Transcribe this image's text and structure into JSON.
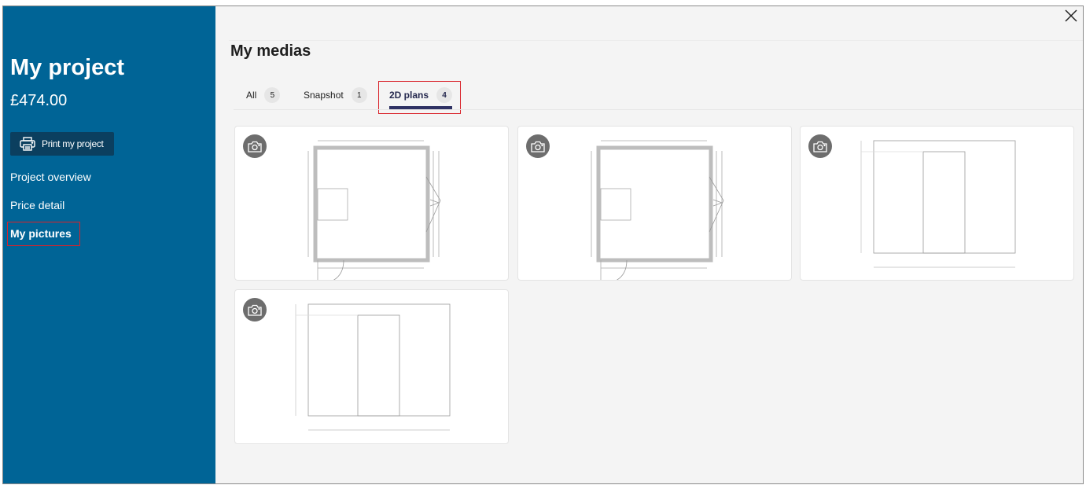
{
  "sidebar": {
    "title": "My project",
    "price": "£474.00",
    "print_label": "Print my project",
    "nav": [
      {
        "label": "Project overview",
        "active": false
      },
      {
        "label": "Price detail",
        "active": false
      },
      {
        "label": "My pictures",
        "active": true
      }
    ]
  },
  "main": {
    "title": "My medias",
    "tabs": [
      {
        "label": "All",
        "count": "5",
        "active": false
      },
      {
        "label": "Snapshot",
        "count": "1",
        "active": false
      },
      {
        "label": "2D plans",
        "count": "4",
        "active": true
      }
    ],
    "media": [
      {
        "type": "2d-plan",
        "view": "floor-plan",
        "icon": "camera-icon"
      },
      {
        "type": "2d-plan",
        "view": "floor-plan",
        "icon": "camera-icon"
      },
      {
        "type": "2d-plan",
        "view": "elevation",
        "icon": "camera-icon"
      },
      {
        "type": "2d-plan",
        "view": "elevation",
        "icon": "camera-icon"
      }
    ]
  },
  "colors": {
    "sidebar_bg": "#006496",
    "print_button_bg": "#0b3f5f",
    "active_tab": "#2e3163",
    "highlight": "#d9222a"
  }
}
